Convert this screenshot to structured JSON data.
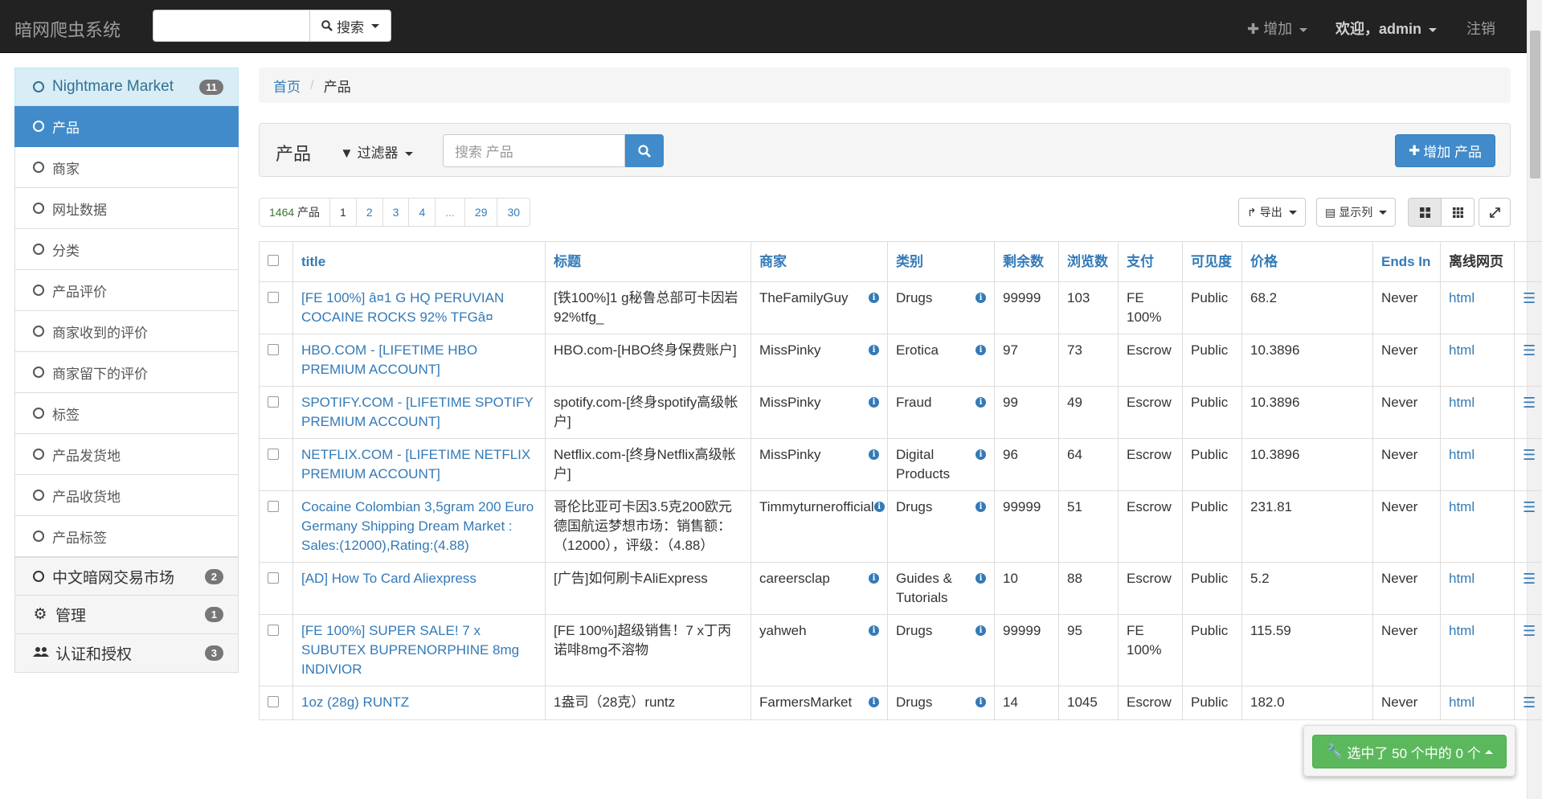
{
  "navbar": {
    "brand": "暗网爬虫系统",
    "search_button": "搜索",
    "add_label": "增加",
    "welcome_label": "欢迎，",
    "user": "admin",
    "logout_label": "注销"
  },
  "sidebar": {
    "groups": [
      {
        "label": "Nightmare Market",
        "badge": "11"
      },
      {
        "label": "中文暗网交易市场",
        "badge": "2"
      },
      {
        "label": "管理",
        "badge": "1"
      },
      {
        "label": "认证和授权",
        "badge": "3"
      }
    ],
    "items": [
      "产品",
      "商家",
      "网址数据",
      "分类",
      "产品评价",
      "商家收到的评价",
      "商家留下的评价",
      "标签",
      "产品发货地",
      "产品收货地",
      "产品标签"
    ]
  },
  "breadcrumb": {
    "home": "首页",
    "current": "产品"
  },
  "panel": {
    "title": "产品",
    "filter_label": "过滤器",
    "search_placeholder": "搜索 产品",
    "add_button": "增加 产品"
  },
  "pagination": {
    "count_number": "1464",
    "count_label": "产品",
    "pages": [
      "1",
      "2",
      "3",
      "4",
      "...",
      "29",
      "30"
    ]
  },
  "toolbar": {
    "export_label": "导出",
    "columns_label": "显示列"
  },
  "table": {
    "headers": [
      "title",
      "标题",
      "商家",
      "类别",
      "剩余数",
      "浏览数",
      "支付",
      "可见度",
      "价格",
      "Ends In",
      "离线网页"
    ],
    "rows": [
      {
        "title": "[FE 100%] â¤1 G HQ PERUVIAN COCAINE ROCKS 92% TFGâ¤",
        "cn_title": "[铁100%]1 g秘鲁总部可卡因岩92%tfg_",
        "vendor": "TheFamilyGuy",
        "category": "Drugs",
        "remaining": "99999",
        "views": "103",
        "payment": "FE 100%",
        "visibility": "Public",
        "price": "68.2",
        "ends": "Never",
        "offline": "html"
      },
      {
        "title": "HBO.COM - [LIFETIME HBO PREMIUM ACCOUNT]",
        "cn_title": "HBO.com-[HBO终身保费账户]",
        "vendor": "MissPinky",
        "category": "Erotica",
        "remaining": "97",
        "views": "73",
        "payment": "Escrow",
        "visibility": "Public",
        "price": "10.3896",
        "ends": "Never",
        "offline": "html"
      },
      {
        "title": "SPOTIFY.COM - [LIFETIME SPOTIFY PREMIUM ACCOUNT]",
        "cn_title": "spotify.com-[终身spotify高级帐户]",
        "vendor": "MissPinky",
        "category": "Fraud",
        "remaining": "99",
        "views": "49",
        "payment": "Escrow",
        "visibility": "Public",
        "price": "10.3896",
        "ends": "Never",
        "offline": "html"
      },
      {
        "title": "NETFLIX.COM - [LIFETIME NETFLIX PREMIUM ACCOUNT]",
        "cn_title": "Netflix.com-[终身Netflix高级帐户]",
        "vendor": "MissPinky",
        "category": "Digital Products",
        "remaining": "96",
        "views": "64",
        "payment": "Escrow",
        "visibility": "Public",
        "price": "10.3896",
        "ends": "Never",
        "offline": "html"
      },
      {
        "title": "Cocaine Colombian 3,5gram 200 Euro Germany Shipping Dream Market : Sales:(12000),Rating:(4.88)",
        "cn_title": "哥伦比亚可卡因3.5克200欧元德国航运梦想市场：销售额：（12000），评级：（4.88）",
        "vendor": "Timmyturnerofficial",
        "category": "Drugs",
        "remaining": "99999",
        "views": "51",
        "payment": "Escrow",
        "visibility": "Public",
        "price": "231.81",
        "ends": "Never",
        "offline": "html"
      },
      {
        "title": "[AD] How To Card Aliexpress",
        "cn_title": "[广告]如何刷卡AliExpress",
        "vendor": "careersclap",
        "category": "Guides & Tutorials",
        "remaining": "10",
        "views": "88",
        "payment": "Escrow",
        "visibility": "Public",
        "price": "5.2",
        "ends": "Never",
        "offline": "html"
      },
      {
        "title": "[FE 100%] SUPER SALE! 7 x SUBUTEX BUPRENORPHINE 8mg INDIVIOR",
        "cn_title": "[FE 100%]超级销售！7 x丁丙诺啡8mg不溶物",
        "vendor": "yahweh",
        "category": "Drugs",
        "remaining": "99999",
        "views": "95",
        "payment": "FE 100%",
        "visibility": "Public",
        "price": "115.59",
        "ends": "Never",
        "offline": "html"
      },
      {
        "title": "1oz (28g) RUNTZ",
        "cn_title": "1盎司（28克）runtz",
        "vendor": "FarmersMarket",
        "category": "Drugs",
        "remaining": "14",
        "views": "1045",
        "payment": "Escrow",
        "visibility": "Public",
        "price": "182.0",
        "ends": "Never",
        "offline": "html"
      }
    ]
  },
  "selection": {
    "label": "选中了 50 个中的 0 个"
  },
  "colors": {
    "primary": "#428bca",
    "link": "#337ab7",
    "success": "#5cb85c",
    "navbar": "#222222"
  }
}
